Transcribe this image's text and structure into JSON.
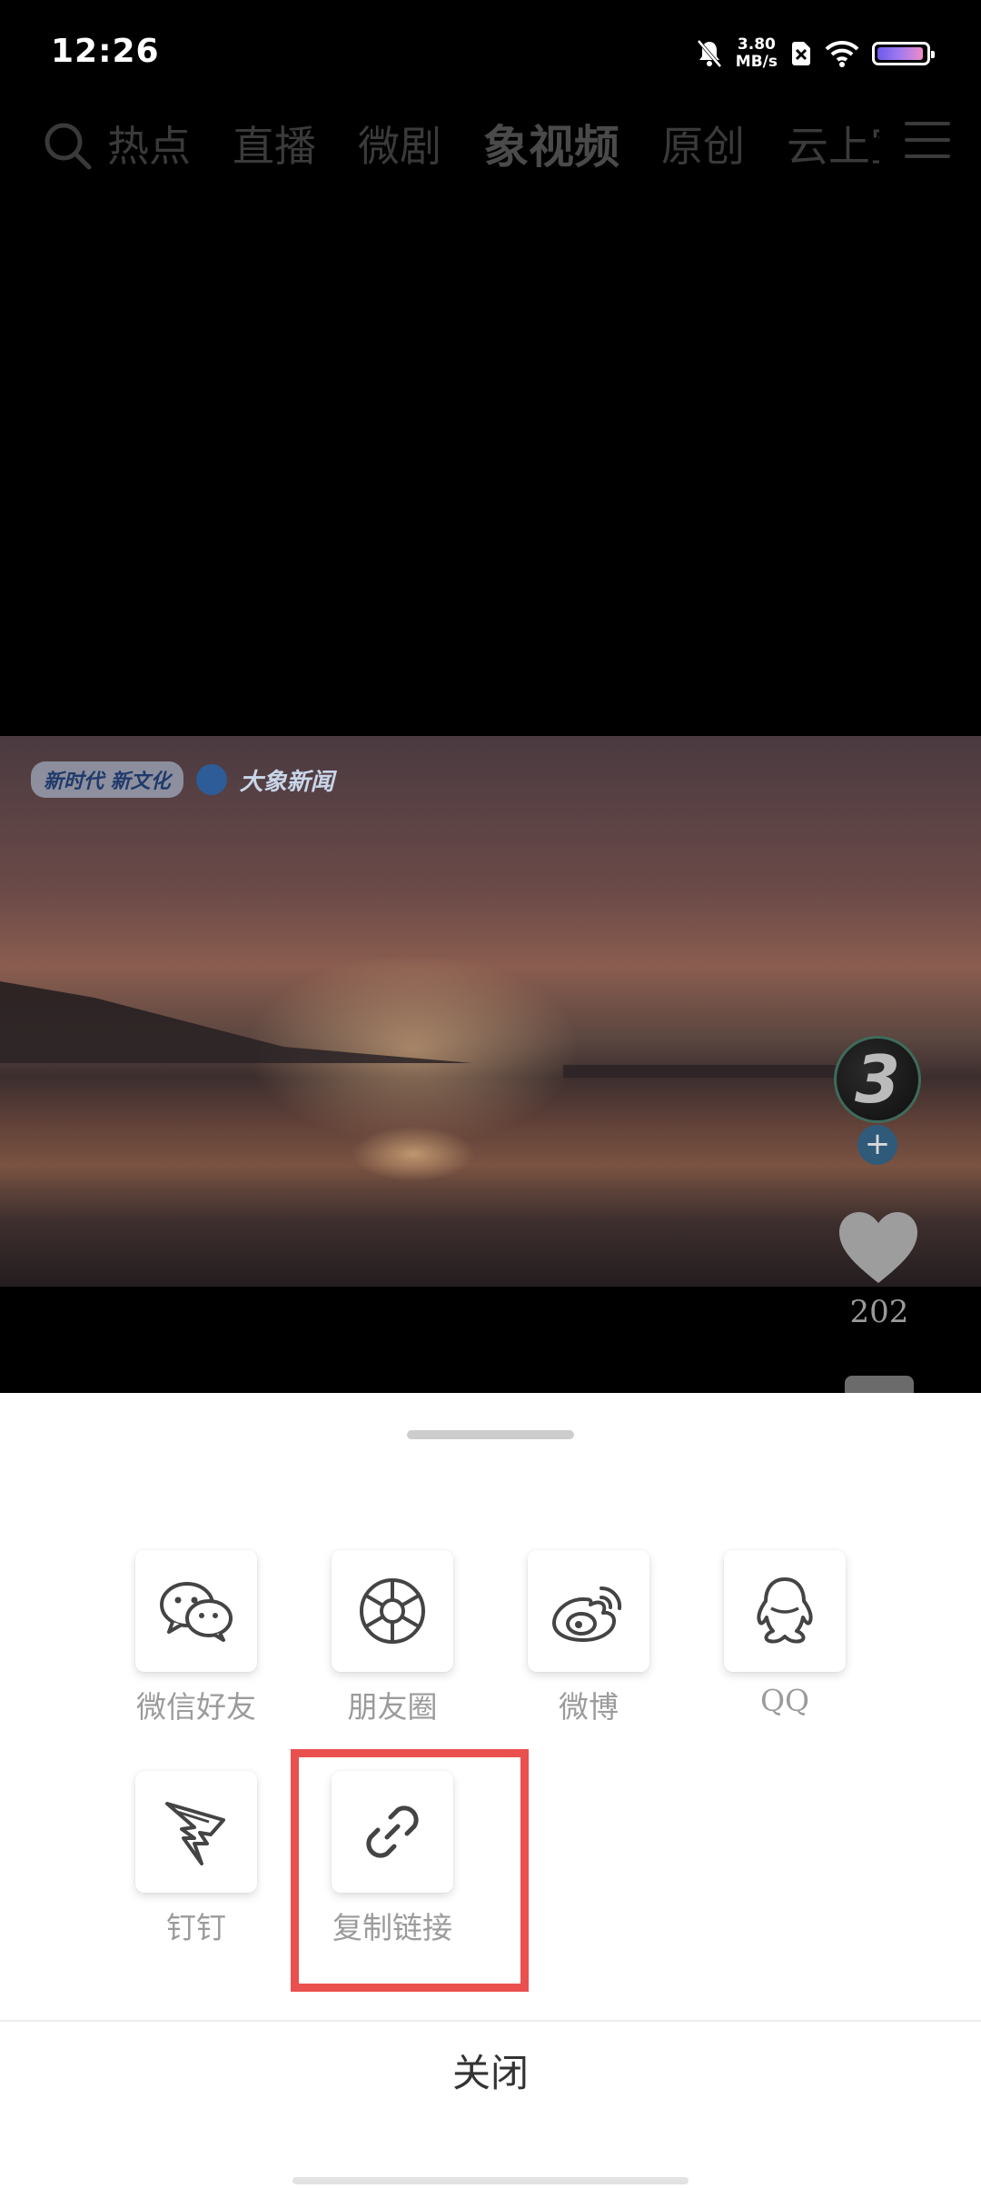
{
  "status_bar": {
    "time": "12:26",
    "net_speed_value": "3.80",
    "net_speed_unit": "MB/s"
  },
  "nav": {
    "tabs": [
      {
        "label": "热点",
        "active": false
      },
      {
        "label": "直播",
        "active": false
      },
      {
        "label": "微剧",
        "active": false
      },
      {
        "label": "象视频",
        "active": true
      },
      {
        "label": "原创",
        "active": false
      },
      {
        "label": "云上宣",
        "active": false
      }
    ]
  },
  "video": {
    "logo_slogan": "新时代 新文化",
    "logo_brand": "大象新闻"
  },
  "rail": {
    "avatar_text": "3",
    "follow_label": "+",
    "like_count": "202"
  },
  "share_sheet": {
    "items": [
      {
        "label": "微信好友",
        "icon": "wechat-icon"
      },
      {
        "label": "朋友圈",
        "icon": "moments-icon"
      },
      {
        "label": "微博",
        "icon": "weibo-icon"
      },
      {
        "label": "QQ",
        "icon": "qq-icon"
      },
      {
        "label": "钉钉",
        "icon": "dingtalk-icon"
      },
      {
        "label": "复制链接",
        "icon": "link-icon"
      }
    ],
    "close_label": "关闭",
    "highlight_color": "#e9504e"
  }
}
